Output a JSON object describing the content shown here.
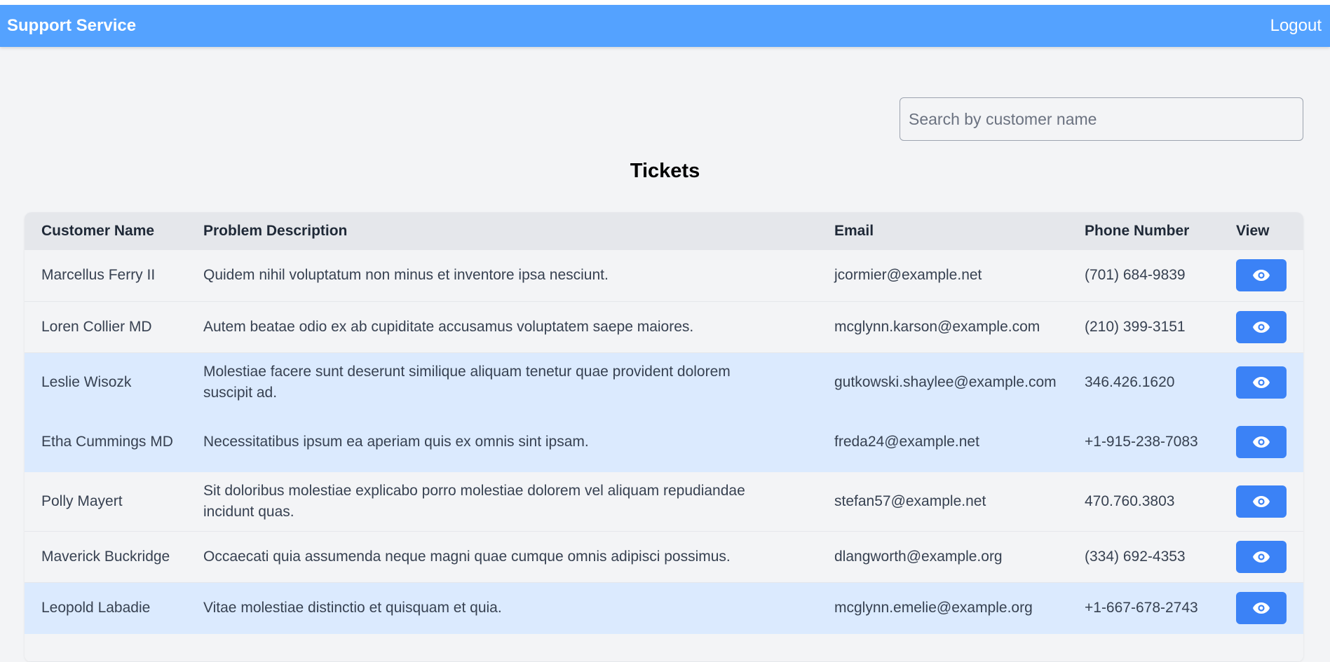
{
  "header": {
    "brand": "Support Service",
    "logout_label": "Logout"
  },
  "search": {
    "placeholder": "Search by customer name",
    "value": ""
  },
  "page_title": "Tickets",
  "table": {
    "columns": {
      "customer_name": "Customer Name",
      "problem_description": "Problem Description",
      "email": "Email",
      "phone_number": "Phone Number",
      "view": "View"
    },
    "rows": [
      {
        "name": "Marcellus Ferry II",
        "description": "Quidem nihil voluptatum non minus et inventore ipsa nesciunt.",
        "email": "jcormier@example.net",
        "phone": "(701) 684-9839",
        "highlighted": false
      },
      {
        "name": "Loren Collier MD",
        "description": "Autem beatae odio ex ab cupiditate accusamus voluptatem saepe maiores.",
        "email": "mcglynn.karson@example.com",
        "phone": "(210) 399-3151",
        "highlighted": false
      },
      {
        "name": "Leslie Wisozk",
        "description": "Molestiae facere sunt deserunt similique aliquam tenetur quae provident dolorem suscipit ad.",
        "email": "gutkowski.shaylee@example.com",
        "phone": "346.426.1620",
        "highlighted": true
      },
      {
        "name": "Etha Cummings MD",
        "description": "Necessitatibus ipsum ea aperiam quis ex omnis sint ipsam.",
        "email": "freda24@example.net",
        "phone": "+1-915-238-7083",
        "highlighted": true
      },
      {
        "name": "Polly Mayert",
        "description": "Sit doloribus molestiae explicabo porro molestiae dolorem vel aliquam repudiandae incidunt quas.",
        "email": "stefan57@example.net",
        "phone": "470.760.3803",
        "highlighted": false
      },
      {
        "name": "Maverick Buckridge",
        "description": "Occaecati quia assumenda neque magni quae cumque omnis adipisci possimus.",
        "email": "dlangworth@example.org",
        "phone": "(334) 692-4353",
        "highlighted": false
      },
      {
        "name": "Leopold Labadie",
        "description": "Vitae molestiae distinctio et quisquam et quia.",
        "email": "mcglynn.emelie@example.org",
        "phone": "+1-667-678-2743",
        "highlighted": true
      }
    ]
  },
  "icons": {
    "view": "eye-icon"
  },
  "colors": {
    "navbar": "#54a2ff",
    "view_button": "#3b82f6",
    "row_highlight": "#dbeafe",
    "background": "#f3f4f6",
    "header_row": "#e5e7eb"
  }
}
